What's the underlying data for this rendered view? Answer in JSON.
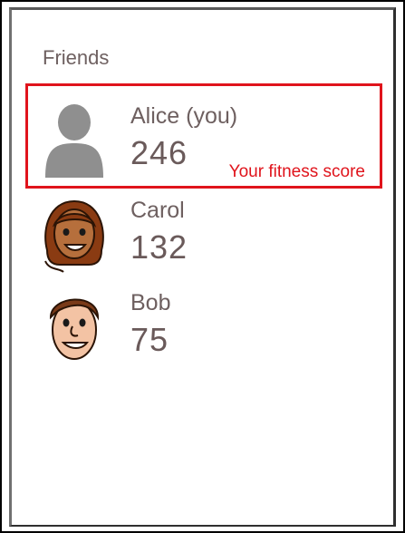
{
  "panel": {
    "title": "Friends"
  },
  "friends": [
    {
      "name": "Alice (you)",
      "score": "246",
      "avatar": "placeholder-person-icon"
    },
    {
      "name": "Carol",
      "score": "132",
      "avatar": "cartoon-girl-avatar"
    },
    {
      "name": "Bob",
      "score": "75",
      "avatar": "cartoon-boy-avatar"
    }
  ],
  "annotation": {
    "callout": "Your fitness score",
    "color": "#e0141c"
  }
}
